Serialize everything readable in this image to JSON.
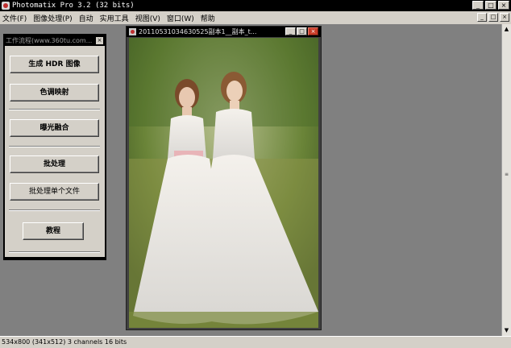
{
  "window": {
    "title": "Photomatix Pro 3.2 (32 bits)",
    "controls": {
      "minimize": "_",
      "maximize": "□",
      "close": "×"
    }
  },
  "menu": [
    "文件(F)",
    "图像处理(P)",
    "自动",
    "实用工具",
    "视图(V)",
    "窗口(W)",
    "帮助"
  ],
  "workflow_panel": {
    "title": "工作流程(www.360tu.com...",
    "close": "×",
    "buttons": {
      "generate_hdr": "生成 HDR 图像",
      "tone_mapping": "色调映射",
      "exposure_fusion": "曝光融合",
      "batch_processing": "批处理",
      "batch_single": "批处理单个文件",
      "tutorial": "教程"
    }
  },
  "image_window": {
    "title": "20110531034630525副本1__副本_t...",
    "controls": {
      "minimize": "_",
      "maximize": "□",
      "close": "×"
    }
  },
  "status_bar": {
    "text": "534x800 (341x512) 3 channels 16 bits"
  },
  "scrollbar": {
    "up": "▲",
    "down": "▼",
    "thumb": "≡"
  }
}
